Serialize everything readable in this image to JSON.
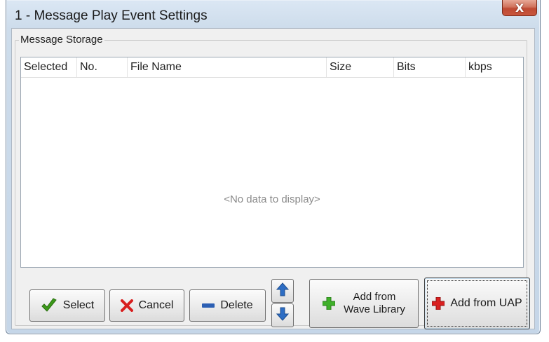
{
  "window": {
    "title": "1 - Message Play Event Settings",
    "close_glyph": "X"
  },
  "group": {
    "label": "Message Storage"
  },
  "grid": {
    "columns": [
      "Selected",
      "No.",
      "File Name",
      "Size",
      "Bits",
      "kbps"
    ],
    "empty_text": "<No data to display>"
  },
  "buttons": {
    "select": "Select",
    "cancel": "Cancel",
    "delete": "Delete",
    "add_wave_line1": "Add from",
    "add_wave_line2": "Wave Library",
    "add_uap": "Add from UAP"
  },
  "colors": {
    "check_green": "#3c9a1a",
    "cancel_red": "#d81e1e",
    "delete_blue": "#2c5fb3",
    "arrow_blue": "#2d6dc4",
    "plus_green": "#3fb02a",
    "plus_red": "#d92020"
  },
  "icons": [
    "checkmark-icon",
    "x-icon",
    "minus-icon",
    "arrow-up-icon",
    "arrow-down-icon",
    "plus-green-icon",
    "plus-red-icon"
  ]
}
